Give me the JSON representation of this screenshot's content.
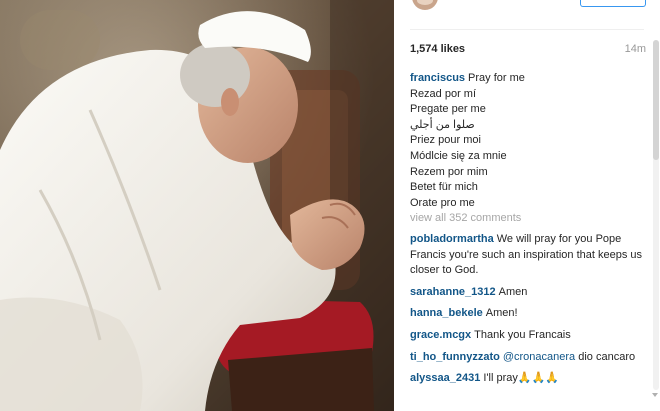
{
  "post": {
    "likes": "1,574 likes",
    "time": "14m"
  },
  "caption": {
    "username": "franciscus",
    "lines": [
      "Pray for me",
      "Rezad por mí",
      "Pregate per me",
      "صلوا من أجلي",
      "Priez pour moi",
      "Módlcie się za mnie",
      "Rezem por mim",
      "Betet für mich",
      "Orate pro me"
    ]
  },
  "view_all_comments": "view all 352 comments",
  "comments": [
    {
      "username": "pobladormartha",
      "text": "We will pray for you Pope Francis you're such an inspiration that keeps us closer to God."
    },
    {
      "username": "sarahanne_1312",
      "text": "Amen"
    },
    {
      "username": "hanna_bekele",
      "text": "Amen!"
    },
    {
      "username": "grace.mcgx",
      "text": "Thank you Francais"
    },
    {
      "username": "ti_ho_funnyzzato",
      "mention": "@cronacanera",
      "text": "dio cancaro"
    },
    {
      "username": "alyssaa_2431",
      "text": "I'll pray🙏🙏🙏"
    }
  ],
  "icons": {
    "avatar": "profile-avatar",
    "follow": "follow-button"
  },
  "colors": {
    "username": "#125688",
    "muted": "#999999",
    "follow_border": "#3897f0",
    "zucchetto_red": "#b71c25"
  }
}
